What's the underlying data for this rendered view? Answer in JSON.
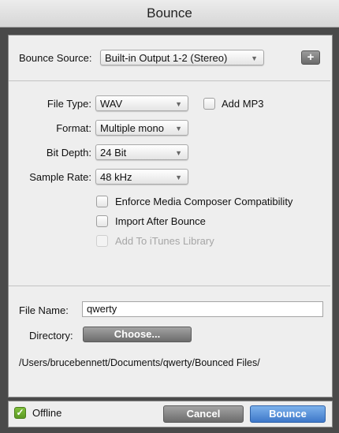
{
  "window": {
    "title": "Bounce"
  },
  "source": {
    "label": "Bounce Source:",
    "value": "Built-in Output 1-2 (Stereo)",
    "add_button": "+"
  },
  "options": {
    "file_type": {
      "label": "File Type:",
      "value": "WAV"
    },
    "add_mp3": {
      "label": "Add MP3",
      "checked": false
    },
    "format": {
      "label": "Format:",
      "value": "Multiple mono"
    },
    "bit_depth": {
      "label": "Bit Depth:",
      "value": "24 Bit"
    },
    "sample_rate": {
      "label": "Sample Rate:",
      "value": "48 kHz"
    },
    "enforce_mc": {
      "label": "Enforce Media Composer Compatibility",
      "checked": false
    },
    "import_after": {
      "label": "Import After Bounce",
      "checked": false
    },
    "add_itunes": {
      "label": "Add To iTunes Library",
      "checked": false,
      "enabled": false
    }
  },
  "file": {
    "name_label": "File Name:",
    "name_value": "qwerty",
    "directory_label": "Directory:",
    "choose_button": "Choose...",
    "path": "/Users/brucebennett/Documents/qwerty/Bounced Files/"
  },
  "footer": {
    "offline_label": "Offline",
    "offline_checked": true,
    "check_glyph": "✓",
    "cancel_button": "Cancel",
    "bounce_button": "Bounce"
  },
  "icons": {
    "chevron": "▼"
  },
  "colors": {
    "accent": "#3e78c9",
    "check_green": "#5d9a24",
    "panel": "#eeeeee"
  }
}
